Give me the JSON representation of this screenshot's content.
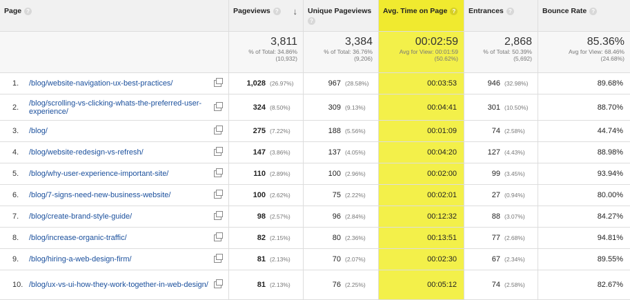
{
  "headers": {
    "page": "Page",
    "pageviews": "Pageviews",
    "unique": "Unique Pageviews",
    "avg_time": "Avg. Time on Page",
    "entrances": "Entrances",
    "bounce": "Bounce Rate",
    "help_glyph": "?",
    "sort_glyph": "↓"
  },
  "totals": {
    "pageviews": {
      "value": "3,811",
      "sub1": "% of Total: 34.86%",
      "sub2": "(10,932)"
    },
    "unique": {
      "value": "3,384",
      "sub1": "% of Total: 36.76%",
      "sub2": "(9,206)"
    },
    "avg_time": {
      "value": "00:02:59",
      "sub1": "Avg for View: 00:01:59",
      "sub2": "(50.62%)"
    },
    "entrances": {
      "value": "2,868",
      "sub1": "% of Total: 50.39%",
      "sub2": "(5,692)"
    },
    "bounce": {
      "value": "85.36%",
      "sub1": "Avg for View: 68.46%",
      "sub2": "(24.68%)"
    }
  },
  "rows": [
    {
      "num": "1.",
      "page": "/blog/website-navigation-ux-best-practices/",
      "pv": "1,028",
      "pv_pct": "(26.97%)",
      "upv": "967",
      "upv_pct": "(28.58%)",
      "time": "00:03:53",
      "ent": "946",
      "ent_pct": "(32.98%)",
      "bounce": "89.68%"
    },
    {
      "num": "2.",
      "page": "/blog/scrolling-vs-clicking-whats-the-preferred-user-experience/",
      "pv": "324",
      "pv_pct": "(8.50%)",
      "upv": "309",
      "upv_pct": "(9.13%)",
      "time": "00:04:41",
      "ent": "301",
      "ent_pct": "(10.50%)",
      "bounce": "88.70%"
    },
    {
      "num": "3.",
      "page": "/blog/",
      "pv": "275",
      "pv_pct": "(7.22%)",
      "upv": "188",
      "upv_pct": "(5.56%)",
      "time": "00:01:09",
      "ent": "74",
      "ent_pct": "(2.58%)",
      "bounce": "44.74%"
    },
    {
      "num": "4.",
      "page": "/blog/website-redesign-vs-refresh/",
      "pv": "147",
      "pv_pct": "(3.86%)",
      "upv": "137",
      "upv_pct": "(4.05%)",
      "time": "00:04:20",
      "ent": "127",
      "ent_pct": "(4.43%)",
      "bounce": "88.98%"
    },
    {
      "num": "5.",
      "page": "/blog/why-user-experience-important-site/",
      "pv": "110",
      "pv_pct": "(2.89%)",
      "upv": "100",
      "upv_pct": "(2.96%)",
      "time": "00:02:00",
      "ent": "99",
      "ent_pct": "(3.45%)",
      "bounce": "93.94%"
    },
    {
      "num": "6.",
      "page": "/blog/7-signs-need-new-business-website/",
      "pv": "100",
      "pv_pct": "(2.62%)",
      "upv": "75",
      "upv_pct": "(2.22%)",
      "time": "00:02:01",
      "ent": "27",
      "ent_pct": "(0.94%)",
      "bounce": "80.00%"
    },
    {
      "num": "7.",
      "page": "/blog/create-brand-style-guide/",
      "pv": "98",
      "pv_pct": "(2.57%)",
      "upv": "96",
      "upv_pct": "(2.84%)",
      "time": "00:12:32",
      "ent": "88",
      "ent_pct": "(3.07%)",
      "bounce": "84.27%"
    },
    {
      "num": "8.",
      "page": "/blog/increase-organic-traffic/",
      "pv": "82",
      "pv_pct": "(2.15%)",
      "upv": "80",
      "upv_pct": "(2.36%)",
      "time": "00:13:51",
      "ent": "77",
      "ent_pct": "(2.68%)",
      "bounce": "94.81%"
    },
    {
      "num": "9.",
      "page": "/blog/hiring-a-web-design-firm/",
      "pv": "81",
      "pv_pct": "(2.13%)",
      "upv": "70",
      "upv_pct": "(2.07%)",
      "time": "00:02:30",
      "ent": "67",
      "ent_pct": "(2.34%)",
      "bounce": "89.55%"
    },
    {
      "num": "10.",
      "page": "/blog/ux-vs-ui-how-they-work-together-in-web-design/",
      "pv": "81",
      "pv_pct": "(2.13%)",
      "upv": "76",
      "upv_pct": "(2.25%)",
      "time": "00:05:12",
      "ent": "74",
      "ent_pct": "(2.58%)",
      "bounce": "82.67%"
    }
  ],
  "colors": {
    "highlight": "#f3f04a",
    "link": "#1a4f9c"
  },
  "icons": {
    "help": "help-icon",
    "sort": "sort-down-icon",
    "external": "external-link-icon"
  }
}
